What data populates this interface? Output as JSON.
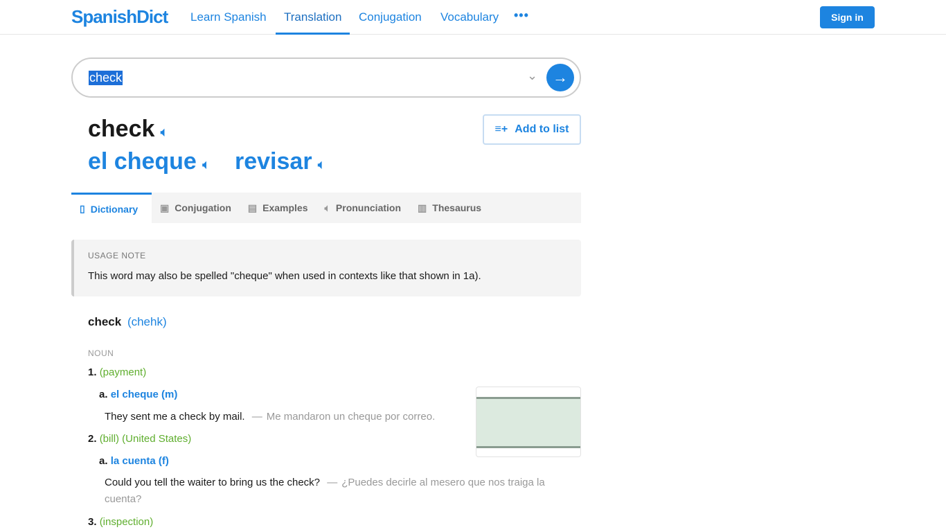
{
  "nav": {
    "logo": "SpanishDict",
    "links": [
      "Learn Spanish",
      "Translation",
      "Conjugation",
      "Vocabulary"
    ],
    "more": "•••",
    "sign_in": "Sign in"
  },
  "search": {
    "value": "check"
  },
  "headword": {
    "word": "check",
    "translations": [
      "el cheque",
      "revisar"
    ],
    "add_to_list": "Add to list"
  },
  "tabs": [
    {
      "label": "Dictionary",
      "icon": "book-icon"
    },
    {
      "label": "Conjugation",
      "icon": "ar-icon"
    },
    {
      "label": "Examples",
      "icon": "chat-icon"
    },
    {
      "label": "Pronunciation",
      "icon": "speaker-icon"
    },
    {
      "label": "Thesaurus",
      "icon": "open-book-icon"
    }
  ],
  "usage_note": {
    "title": "USAGE NOTE",
    "text": "This word may also be spelled \"cheque\" when used in contexts like that shown in 1a)."
  },
  "entry": {
    "word": "check",
    "pron": "(chehk)",
    "pos": "NOUN",
    "senses": [
      {
        "num": "1.",
        "context": "(payment)",
        "sub": "a.",
        "trans": "el cheque (m)",
        "ex_en": "They sent me a check by mail.",
        "ex_es": "Me mandaron un cheque por correo."
      },
      {
        "num": "2.",
        "context": "(bill) (United States)",
        "sub": "a.",
        "trans": "la cuenta (f)",
        "ex_en": "Could you tell the waiter to bring us the check?",
        "ex_es": "¿Puedes decirle al mesero que nos traiga la cuenta?"
      },
      {
        "num": "3.",
        "context": "(inspection)"
      }
    ]
  },
  "dash": "—"
}
